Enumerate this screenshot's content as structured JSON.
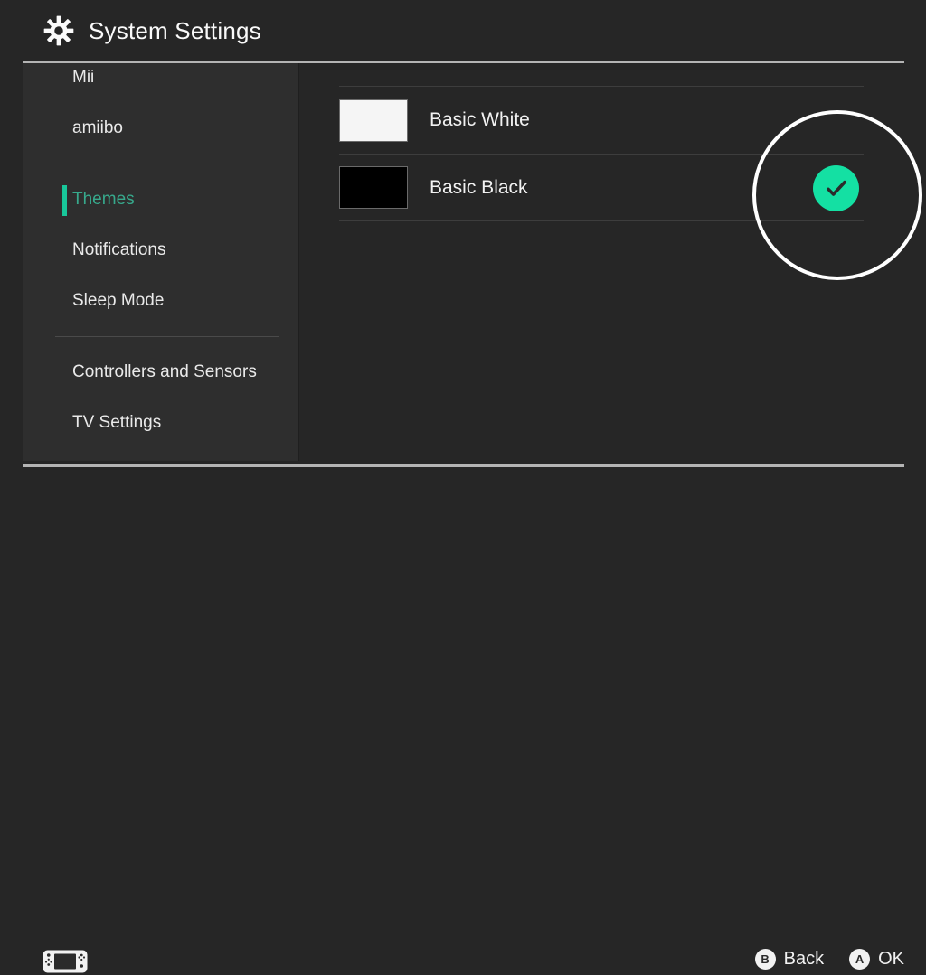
{
  "header": {
    "title": "System Settings",
    "icon": "gear-icon"
  },
  "sidebar": {
    "groups": [
      {
        "items": [
          {
            "label": "Mii",
            "active": false
          },
          {
            "label": "amiibo",
            "active": false
          }
        ]
      },
      {
        "items": [
          {
            "label": "Themes",
            "active": true
          },
          {
            "label": "Notifications",
            "active": false
          },
          {
            "label": "Sleep Mode",
            "active": false
          }
        ]
      },
      {
        "items": [
          {
            "label": "Controllers and Sensors",
            "active": false
          },
          {
            "label": "TV Settings",
            "active": false
          }
        ]
      }
    ]
  },
  "main": {
    "themes": [
      {
        "label": "Basic White",
        "swatch_color": "#f5f5f5",
        "selected": false
      },
      {
        "label": "Basic Black",
        "swatch_color": "#000000",
        "selected": true
      }
    ],
    "selected_check_icon": "check-icon"
  },
  "annotation": {
    "shape": "circle-highlight",
    "color": "#ffffff",
    "targets": "basic-black-selected-check"
  },
  "footer": {
    "device_icon": "nintendo-switch-console-icon",
    "actions": [
      {
        "button": "B",
        "label": "Back"
      },
      {
        "button": "A",
        "label": "OK"
      }
    ]
  },
  "colors": {
    "background": "#262626",
    "sidebar_background": "#2e2e2e",
    "accent_teal": "#14e0a3",
    "accent_text": "#37a98c",
    "rule": "#b4b4b4",
    "divider": "#3d3d3d"
  }
}
